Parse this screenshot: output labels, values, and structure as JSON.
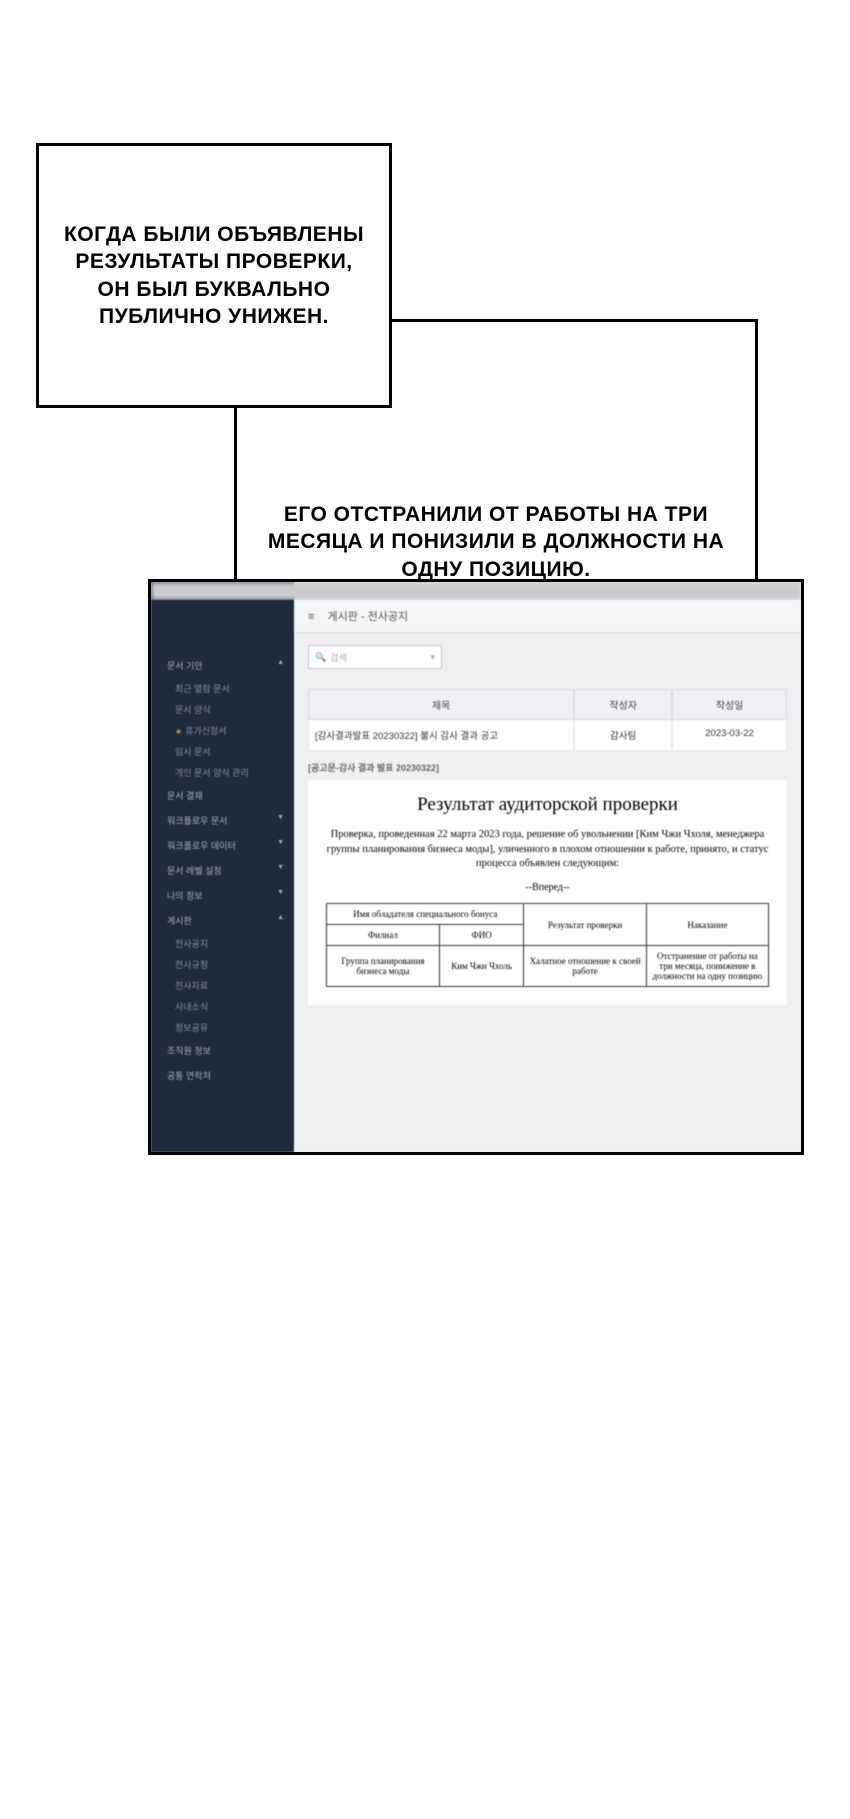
{
  "caption1": "КОГДА БЫЛИ ОБЪЯВЛЕНЫ РЕЗУЛЬТАТЫ ПРОВЕРКИ, ОН БЫЛ БУКВАЛЬНО ПУБЛИЧНО УНИЖЕН.",
  "caption2": "ЕГО ОТСТРАНИЛИ ОТ РАБОТЫ НА ТРИ МЕСЯЦА И ПОНИЗИЛИ В ДОЛЖНОСТИ НА ОДНУ ПОЗИЦИЮ.",
  "breadcrumb": "게시판 - 전사공지",
  "search_placeholder": "검색",
  "table_headers": {
    "title": "제목",
    "author": "작성자",
    "date": "작성일"
  },
  "post": {
    "title": "[감사결과발표 20230322] 불시 감사 결과 공고",
    "author": "감사팀",
    "date": "2023-03-22"
  },
  "doc_label": "[공고문-감사 결과 발표 20230322]",
  "doc_title": "Результат аудиторской проверки",
  "doc_body": "Проверка, проведенная 22 марта 2023 года, решение об увольнении [Ким Чжи Чхоля, менеджера группы планирования бизнеса моды], уличенного в плохом отношении к работе, принято, и статус процесса объявлен следующим:",
  "doc_forward": "--Вперед--",
  "audit_headers": {
    "bonus": "Имя обладателя специального бонуса",
    "branch": "Филиал",
    "name": "ФИО",
    "result": "Результат проверки",
    "punishment": "Наказание"
  },
  "audit_row": {
    "branch": "Группа планирования бизнеса моды",
    "name": "Ким Чжи Чхоль",
    "result": "Халатное отношение к своей работе",
    "punishment": "Отстранение от работы на три месяца, понижение в должности на одну позицию"
  },
  "sidebar": {
    "s1": "문서 기안",
    "s1a": "최근 열람 문서",
    "s1b": "문서 양식",
    "s1c": "휴가신청서",
    "s1d": "임시 문서",
    "s1e": "개인 문서 양식 관리",
    "s2": "문서 결재",
    "s3": "워크플로우 문서",
    "s4": "워크플로우 데이터",
    "s5": "문서 레벨 설정",
    "s6": "나의 정보",
    "s7": "게시판",
    "s7a": "전사공지",
    "s7b": "전사규정",
    "s7c": "전사자료",
    "s7d": "사내소식",
    "s7e": "정보공유",
    "s8": "조직원 정보",
    "s9": "공통 연락처"
  }
}
